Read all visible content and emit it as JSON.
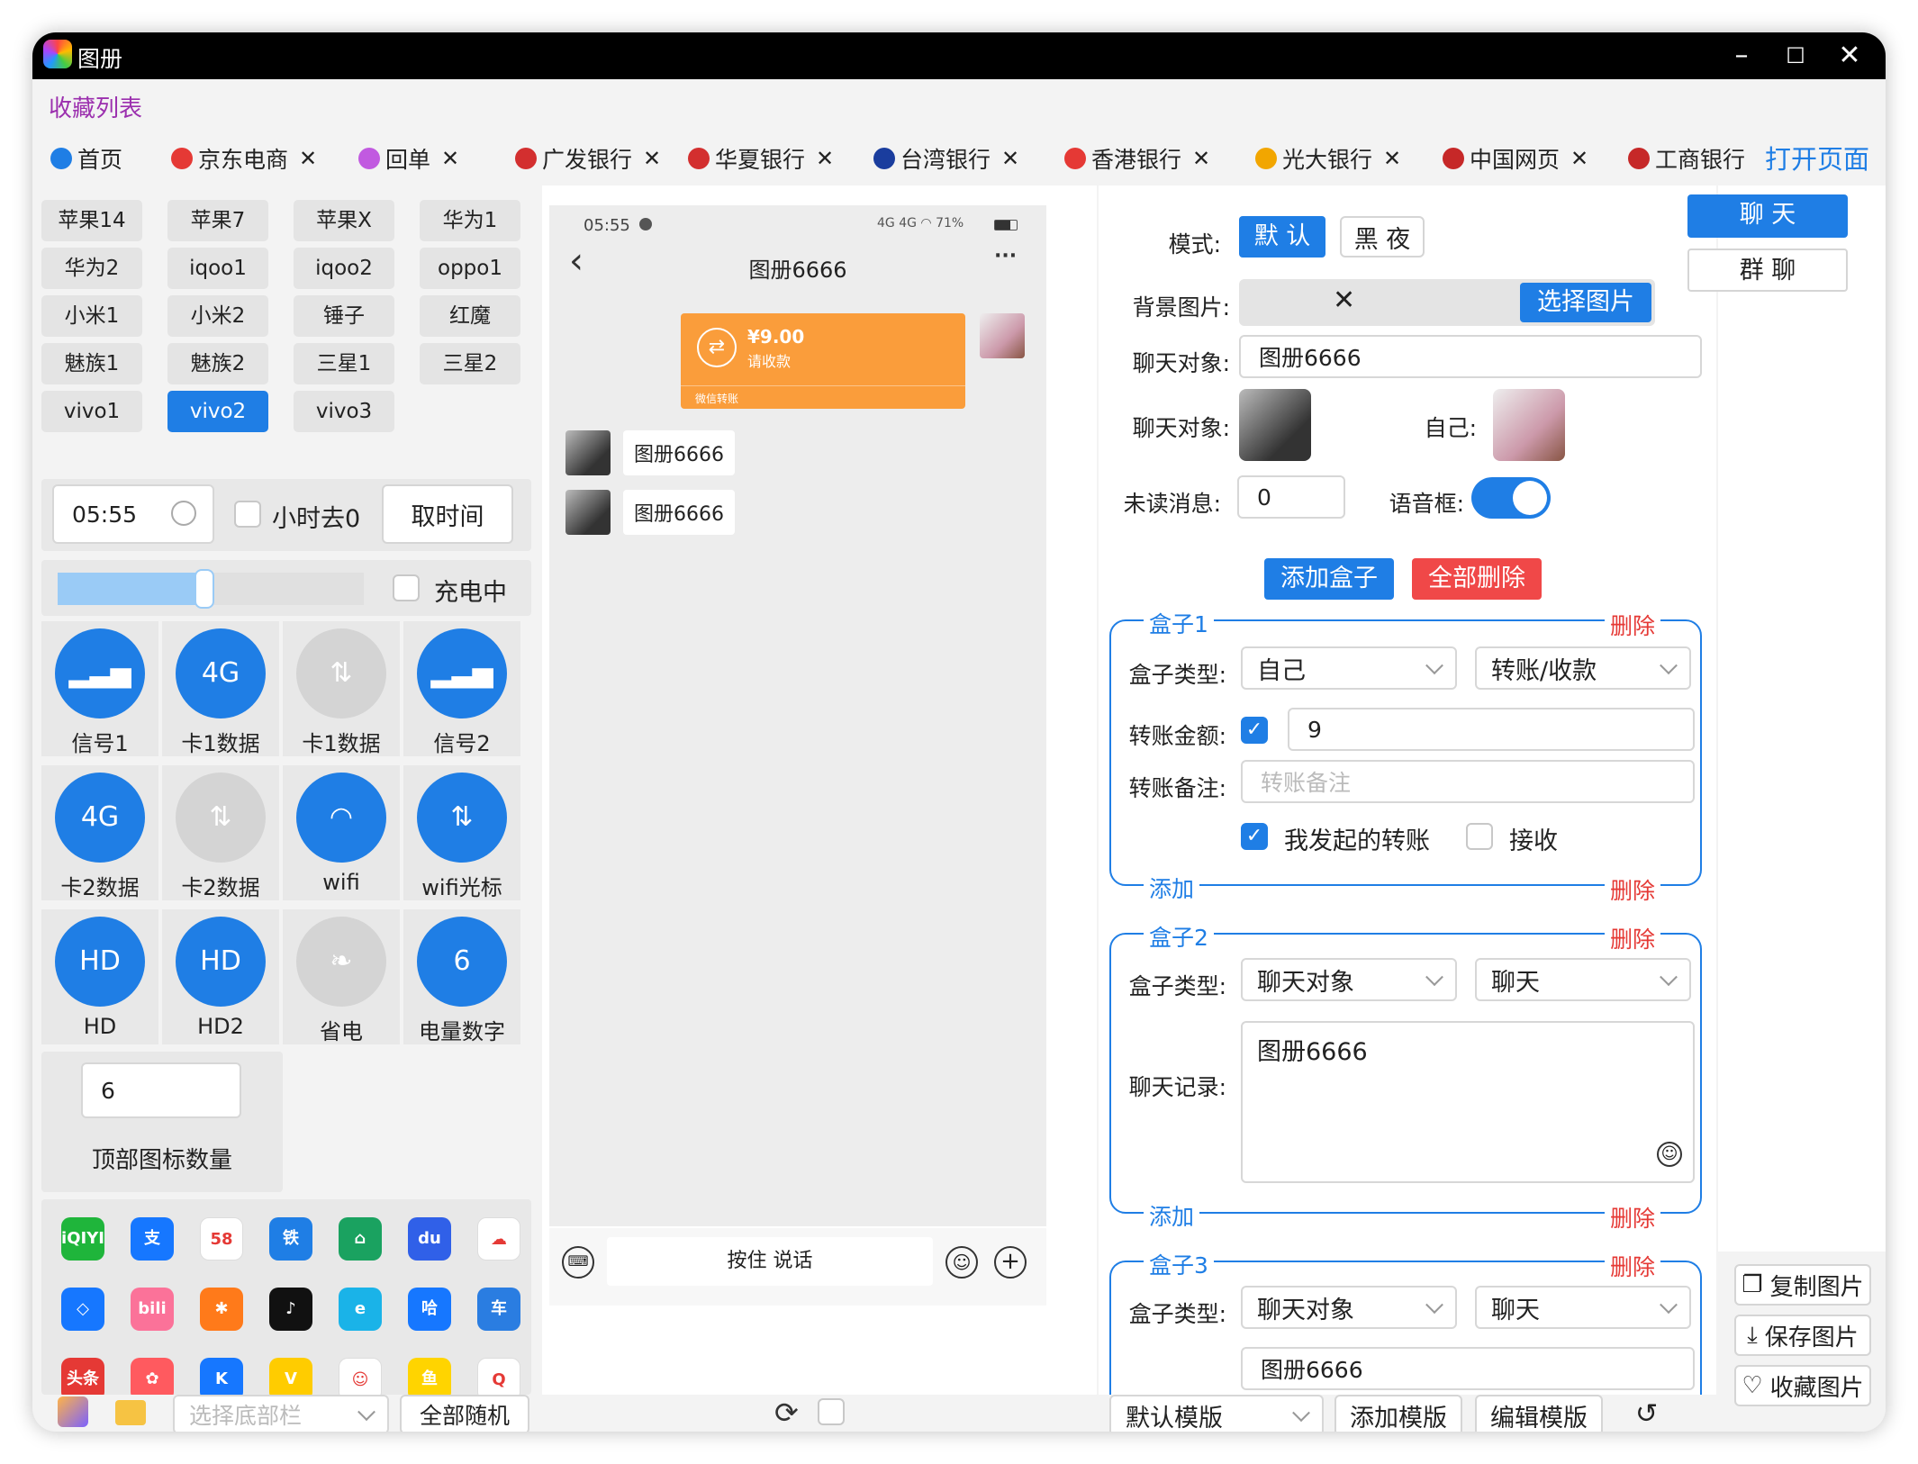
{
  "window": {
    "title": "图册",
    "min_icon": "minimize-icon",
    "max_icon": "maximize-icon",
    "close_icon": "close-icon"
  },
  "favorites": {
    "label": "收藏列表"
  },
  "tabs": [
    {
      "label": "首页",
      "icon": "home-icon",
      "color": "#1f7ee5"
    },
    {
      "label": "京东电商",
      "icon": "jd-icon",
      "color": "#e53935"
    },
    {
      "label": "回单",
      "icon": "receipt-icon",
      "color": "#c15ae0"
    },
    {
      "label": "广发银行",
      "icon": "cgb-icon",
      "color": "#d32f2f"
    },
    {
      "label": "华夏银行",
      "icon": "hxb-icon",
      "color": "#d32f2f"
    },
    {
      "label": "台湾银行",
      "icon": "bot-icon",
      "color": "#1a3d9e"
    },
    {
      "label": "香港银行",
      "icon": "hk-icon",
      "color": "#e53935"
    },
    {
      "label": "光大银行",
      "icon": "ceb-icon",
      "color": "#f2a600"
    },
    {
      "label": "中国网页",
      "icon": "china-icon",
      "color": "#c62828"
    },
    {
      "label": "工商银行",
      "icon": "icbc-icon",
      "color": "#c62828"
    }
  ],
  "open_page": "打开页面",
  "tab_close": "✕",
  "devices": [
    "苹果14",
    "苹果7",
    "苹果X",
    "华为1",
    "华为2",
    "iqoo1",
    "iqoo2",
    "oppo1",
    "小米1",
    "小米2",
    "锤子",
    "红魔",
    "魅族1",
    "魅族2",
    "三星1",
    "三星2",
    "vivo1",
    "vivo2",
    "vivo3"
  ],
  "selected_device": "vivo2",
  "time": {
    "value": "05:55",
    "clock_icon": "clock-icon",
    "hour_label": "小时去0",
    "get_time": "取时间"
  },
  "battery": {
    "level": 0.48,
    "charging_label": "充电中"
  },
  "signals": [
    {
      "label": "信号1",
      "glyph": "▂▃▅",
      "on": true
    },
    {
      "label": "卡1数据",
      "glyph": "4G",
      "on": true
    },
    {
      "label": "卡1数据",
      "glyph": "⇅",
      "on": false
    },
    {
      "label": "信号2",
      "glyph": "▂▃▅",
      "on": true
    },
    {
      "label": "卡2数据",
      "glyph": "4G",
      "on": true
    },
    {
      "label": "卡2数据",
      "glyph": "⇅",
      "on": false
    },
    {
      "label": "wifi",
      "glyph": "◠",
      "on": true
    },
    {
      "label": "wifi光标",
      "glyph": "⇅",
      "on": true
    },
    {
      "label": "HD",
      "glyph": "HD",
      "on": true
    },
    {
      "label": "HD2",
      "glyph": "HD",
      "on": true
    },
    {
      "label": "省电",
      "glyph": "❧",
      "on": false
    },
    {
      "label": "电量数字",
      "glyph": "6",
      "on": true
    }
  ],
  "top_icons": {
    "value": "6",
    "label": "顶部图标数量"
  },
  "apps": [
    {
      "name": "iqiyi-icon",
      "text": "iQIYI",
      "color": "#1fb53b"
    },
    {
      "name": "alipay-icon",
      "text": "支",
      "color": "#1677ff"
    },
    {
      "name": "58-icon",
      "text": "58",
      "color": "#ffffff"
    },
    {
      "name": "railway-icon",
      "text": "铁",
      "color": "#1f7ee5"
    },
    {
      "name": "vr-house-icon",
      "text": "⌂",
      "color": "#1aa260"
    },
    {
      "name": "baidu-icon",
      "text": "du",
      "color": "#3060e8"
    },
    {
      "name": "baidu-cloud-icon",
      "text": "☁",
      "color": "#ffffff"
    },
    {
      "name": "app-blue-icon",
      "text": "◇",
      "color": "#1677ff"
    },
    {
      "name": "bilibili-icon",
      "text": "bili",
      "color": "#fb7299"
    },
    {
      "name": "orange-icon",
      "text": "✱",
      "color": "#ff7a1a"
    },
    {
      "name": "tiktok-icon",
      "text": "♪",
      "color": "#111111"
    },
    {
      "name": "e-icon",
      "text": "e",
      "color": "#1ab3e8"
    },
    {
      "name": "hello-icon",
      "text": "哈",
      "color": "#1677ff"
    },
    {
      "name": "car-icon",
      "text": "车",
      "color": "#2a7de1"
    },
    {
      "name": "toutiao-icon",
      "text": "头条",
      "color": "#e53935"
    },
    {
      "name": "pink-icon",
      "text": "✿",
      "color": "#ff5a5f"
    },
    {
      "name": "k-icon",
      "text": "K",
      "color": "#1677ff"
    },
    {
      "name": "yellow-icon",
      "text": "V",
      "color": "#ffcc00"
    },
    {
      "name": "penguin-icon",
      "text": "☺",
      "color": "#ffffff"
    },
    {
      "name": "fish-icon",
      "text": "鱼",
      "color": "#ffd400"
    },
    {
      "name": "qq-icon",
      "text": "Q",
      "color": "#ffffff"
    }
  ],
  "bottom_left": {
    "select_placeholder": "选择底部栏",
    "random": "全部随机"
  },
  "phone": {
    "status_time": "05:55",
    "status_right": "4G 4G ◠ 71%",
    "chat_title": "图册6666",
    "back": "‹",
    "more": "···",
    "transfer_amount": "¥9.00",
    "transfer_note": "请收款",
    "transfer_footer": "微信转账",
    "msg1": "图册6666",
    "msg2": "图册6666",
    "input_hint": "按住 说话"
  },
  "settings": {
    "mode_label": "模式:",
    "mode_default": "默 认",
    "mode_night": "黑 夜",
    "bg_label": "背景图片:",
    "bg_clear": "✕",
    "bg_choose": "选择图片",
    "chat_target_label": "聊天对象:",
    "chat_target_value": "图册6666",
    "avatar_target_label": "聊天对象:",
    "avatar_self_label": "自己:",
    "unread_label": "未读消息:",
    "unread_value": "0",
    "voice_label": "语音框:",
    "voice_on": true,
    "add_box": "添加盒子",
    "delete_all": "全部删除",
    "box_type_label": "盒子类型:",
    "add": "添加",
    "delete": "删除",
    "boxes": [
      {
        "title": "盒子1",
        "type": "自己",
        "kind": "转账/收款",
        "amount_label": "转账金额:",
        "amount": "9",
        "note_label": "转账备注:",
        "note_placeholder": "转账备注",
        "mine_label": "我发起的转账",
        "receive_label": "接收"
      },
      {
        "title": "盒子2",
        "type": "聊天对象",
        "kind": "聊天",
        "record_label": "聊天记录:",
        "record": "图册6666"
      },
      {
        "title": "盒子3",
        "type": "聊天对象",
        "kind": "聊天",
        "record": "图册6666"
      }
    ]
  },
  "bottom_mid": {
    "template": "默认模版",
    "add_template": "添加模版",
    "edit_template": "编辑模版"
  },
  "right": {
    "chat": "聊 天",
    "group_chat": "群 聊",
    "copy": "复制图片",
    "save": "保存图片",
    "fav": "收藏图片"
  },
  "colors": {
    "accent": "#1f7ee5",
    "danger": "#e53935",
    "transfer": "#fa9d3b"
  }
}
